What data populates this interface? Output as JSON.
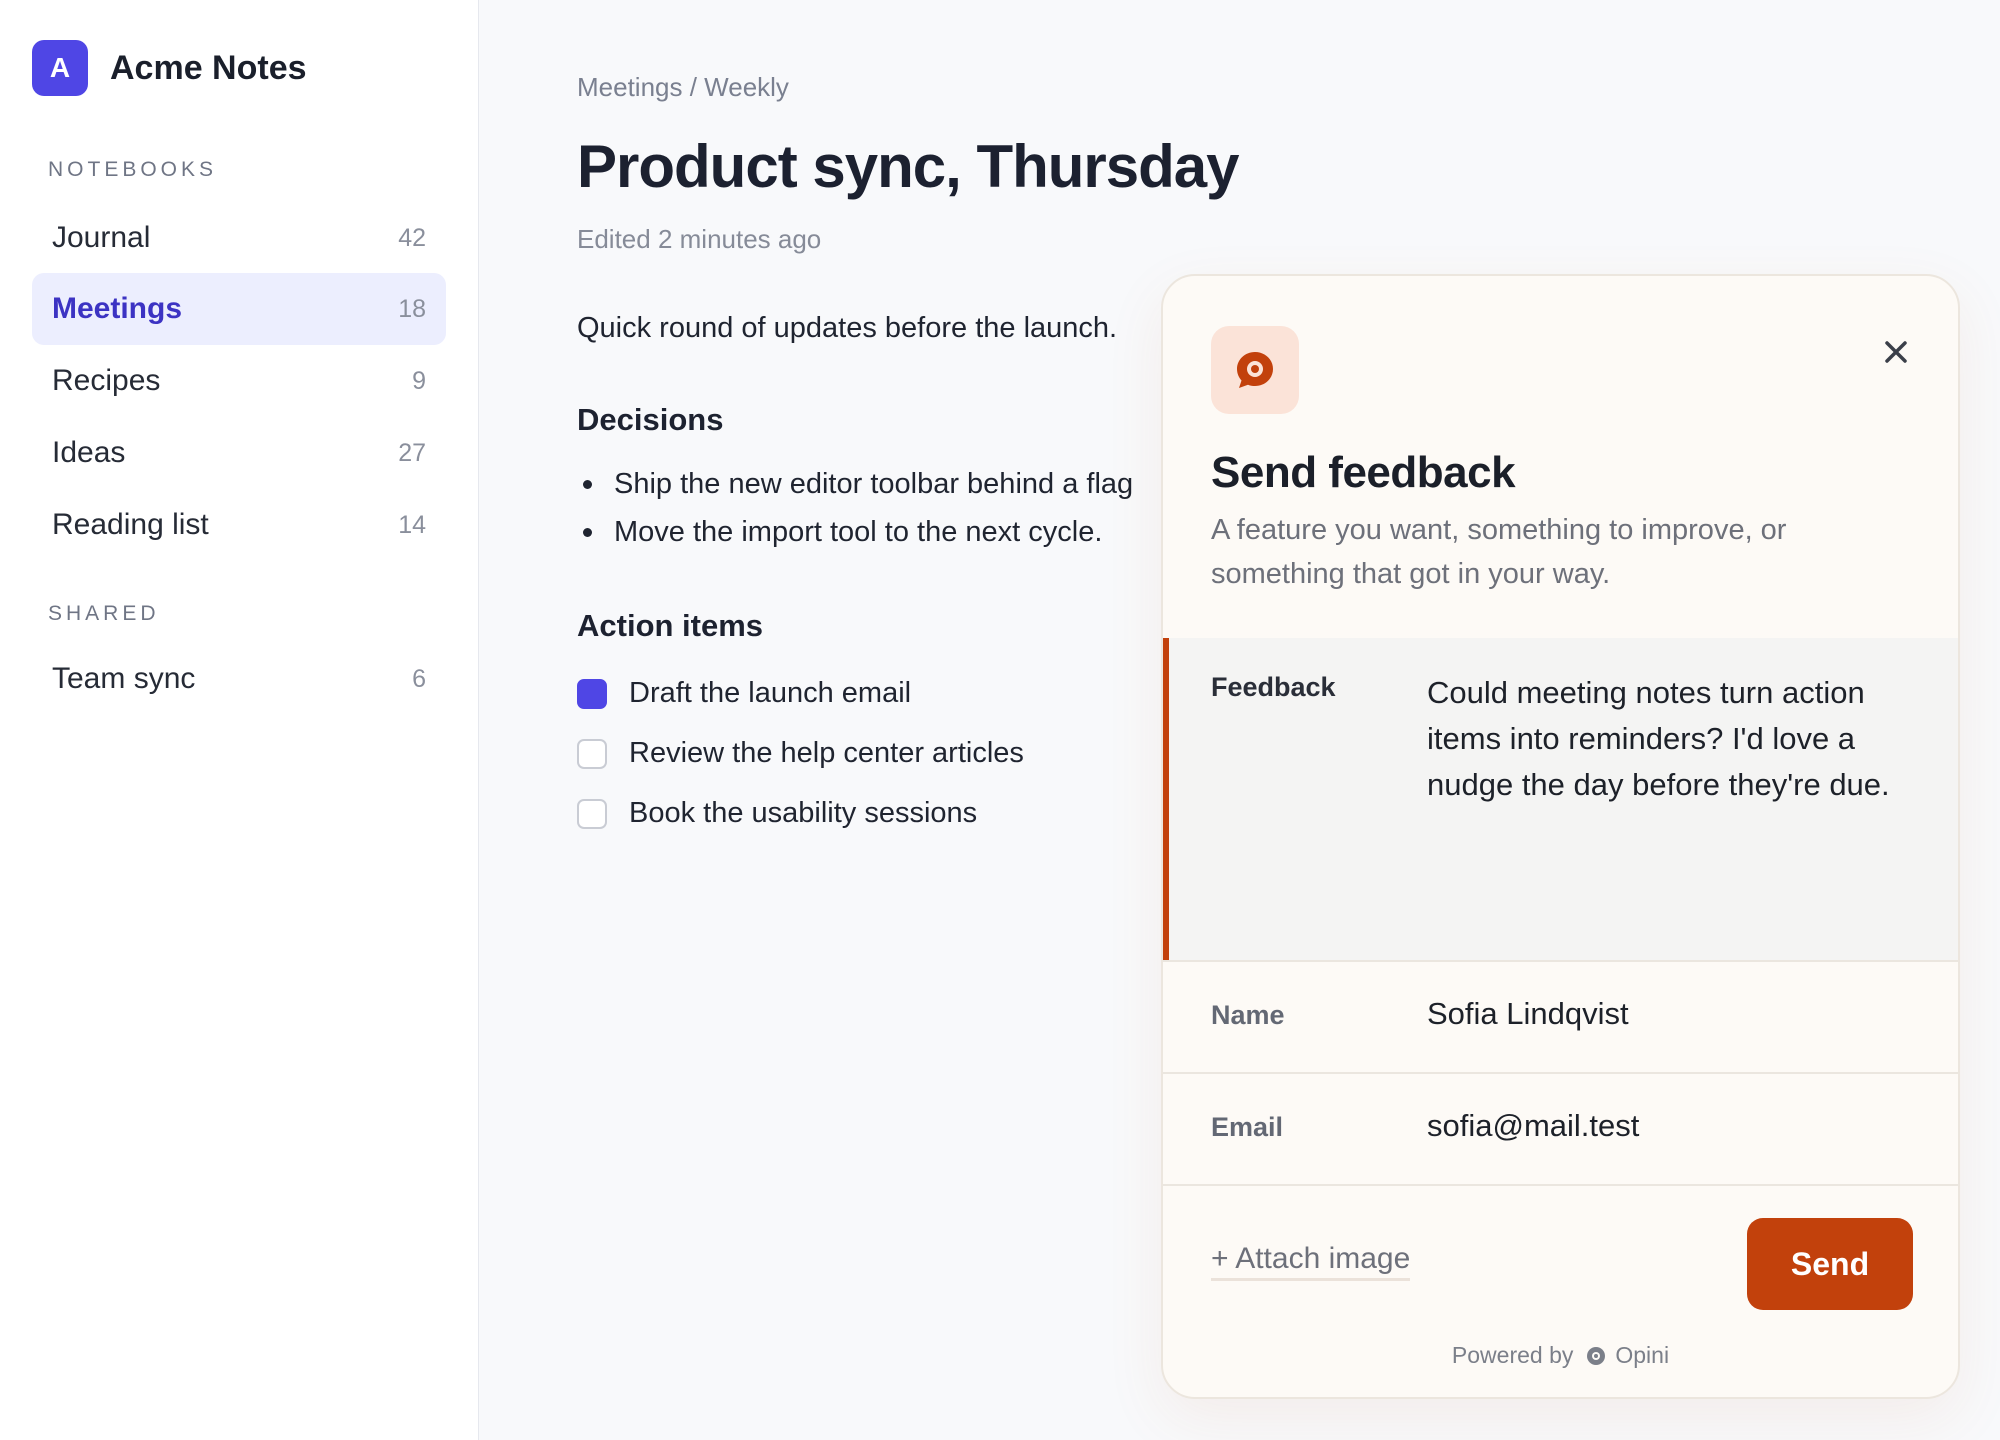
{
  "app": {
    "brand_initial": "A",
    "brand_name": "Acme Notes",
    "accent_color": "#4f46e5"
  },
  "sidebar": {
    "notebooks_label": "NOTEBOOKS",
    "notebooks": [
      {
        "label": "Journal",
        "count": "42",
        "active": false
      },
      {
        "label": "Meetings",
        "count": "18",
        "active": true
      },
      {
        "label": "Recipes",
        "count": "9",
        "active": false
      },
      {
        "label": "Ideas",
        "count": "27",
        "active": false
      },
      {
        "label": "Reading list",
        "count": "14",
        "active": false
      }
    ],
    "shared_label": "SHARED",
    "shared": [
      {
        "label": "Team sync",
        "count": "6",
        "active": false
      }
    ]
  },
  "note": {
    "breadcrumb": "Meetings / Weekly",
    "title": "Product sync, Thursday",
    "meta": "Edited 2 minutes ago",
    "intro": "Quick round of updates before the launch.",
    "decisions_heading": "Decisions",
    "decisions": [
      "Ship the new editor toolbar behind a flag",
      "Move the import tool to the next cycle."
    ],
    "action_items_heading": "Action items",
    "action_items": [
      {
        "label": "Draft the launch email",
        "checked": true
      },
      {
        "label": "Review the help center articles",
        "checked": false
      },
      {
        "label": "Book the usability sessions",
        "checked": false
      }
    ]
  },
  "feedback_widget": {
    "icon": "chat-bubble-icon",
    "accent_color": "#c2410c",
    "title": "Send feedback",
    "subtitle": "A feature you want, something to improve, or something that got in your way.",
    "feedback_label": "Feedback",
    "feedback_value": "Could meeting notes turn action items into reminders? I'd love a nudge the day before they're due.",
    "name_label": "Name",
    "name_value": "Sofia Lindqvist",
    "email_label": "Email",
    "email_value": "sofia@mail.test",
    "attach_label": "+ Attach image",
    "send_label": "Send",
    "powered_by_label": "Powered by",
    "powered_by_brand": "Opini"
  }
}
